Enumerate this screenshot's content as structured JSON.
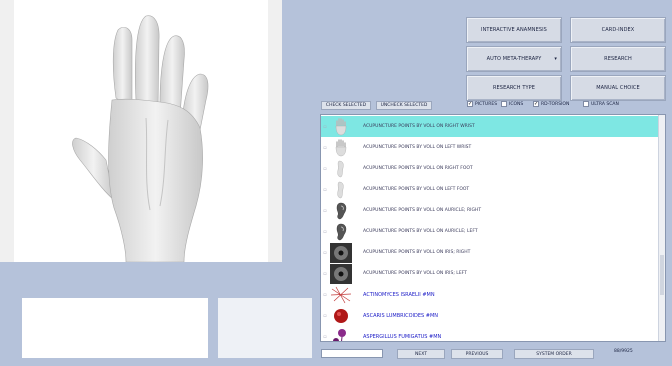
{
  "top_buttons": {
    "interactive_anamnesis": "INTERACTIVE ANAMNESIS",
    "card_index": "CARD-INDEX",
    "auto_meta_therapy": "AUTO META-THERAPY",
    "research": "RESEARCH",
    "research_type": "RESEARCH TYPE",
    "manual_choice": "MANUAL CHOICE"
  },
  "selection": {
    "check_selected": "CHECK SELECTED",
    "uncheck_selected": "UNCHECK SELECTED"
  },
  "options": {
    "pictures": "PICTURES",
    "icons": "ICONS",
    "rd_torsion": "RD-TORSION",
    "ultra_scan": "ULTRA SCAN"
  },
  "list_items": [
    {
      "label": "ACUPUNCTURE POINTS BY VOLL ON RIGHT WRIST",
      "selected": true,
      "thumb": "hand-icon"
    },
    {
      "label": "ACUPUNCTURE POINTS BY VOLL ON LEFT WRIST",
      "selected": false,
      "thumb": "hand-icon"
    },
    {
      "label": "ACUPUNCTURE POINTS BY VOLL ON RIGHT FOOT",
      "selected": false,
      "thumb": "foot-icon"
    },
    {
      "label": "ACUPUNCTURE POINTS BY VOLL ON LEFT FOOT",
      "selected": false,
      "thumb": "foot-icon"
    },
    {
      "label": "ACUPUNCTURE POINTS BY VOLL ON AURICLE; RIGHT",
      "selected": false,
      "thumb": "ear-icon"
    },
    {
      "label": "ACUPUNCTURE POINTS BY VOLL ON AURICLE; LEFT",
      "selected": false,
      "thumb": "ear-icon"
    },
    {
      "label": "ACUPUNCTURE POINTS BY VOLL ON IRIS; RIGHT",
      "selected": false,
      "thumb": "iris-icon"
    },
    {
      "label": "ACUPUNCTURE POINTS BY VOLL ON IRIS; LEFT",
      "selected": false,
      "thumb": "iris-icon"
    },
    {
      "label": "ACTINOMYCES ISRAELII #MN",
      "selected": false,
      "thumb": "microbe-icon",
      "blue": true
    },
    {
      "label": "ASCARIS LUMBRICOIDES #MN",
      "selected": false,
      "thumb": "parasite-icon",
      "blue": true
    },
    {
      "label": "ASPERGILLUS FUMIGATUS #MN",
      "selected": false,
      "thumb": "fungus-icon",
      "blue": true
    }
  ],
  "nav": {
    "next": "NEXT",
    "previous": "PREVIOUS",
    "system_order": "SYSTEM ORDER",
    "counter": "88/9925"
  },
  "colors": {
    "background": "#b5c2da",
    "selected_row": "#7ee7e3",
    "link_blue": "#2020c8"
  }
}
